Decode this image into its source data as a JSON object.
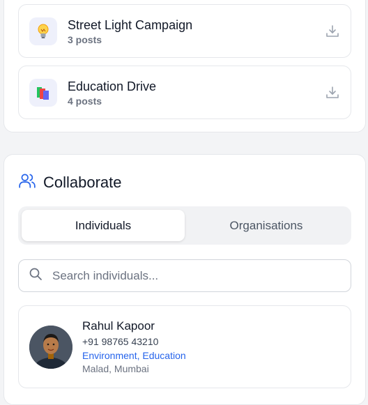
{
  "campaigns": [
    {
      "title": "Street Light Campaign",
      "posts": "3 posts",
      "icon": "lightbulb-icon"
    },
    {
      "title": "Education Drive",
      "posts": "4 posts",
      "icon": "books-icon"
    }
  ],
  "collaborate": {
    "title": "Collaborate",
    "icon": "users-icon",
    "tabs": [
      {
        "label": "Individuals",
        "active": true
      },
      {
        "label": "Organisations",
        "active": false
      }
    ],
    "search_placeholder": "Search individuals...",
    "people": [
      {
        "name": "Rahul Kapoor",
        "phone": "+91 98765 43210",
        "tags": "Environment, Education",
        "location": "Malad, Mumbai"
      }
    ]
  },
  "colors": {
    "accent": "#2563eb",
    "border": "#e5e7eb",
    "muted": "#6b7280"
  }
}
